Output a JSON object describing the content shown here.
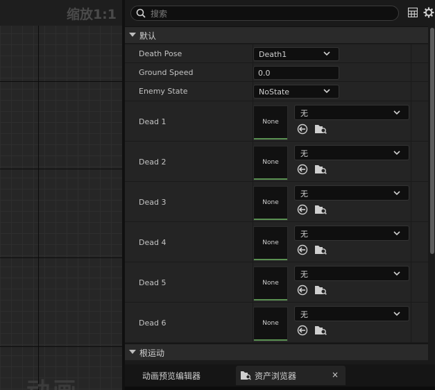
{
  "viewport": {
    "zoom_label": "缩放1:1",
    "ghost_text": "动画"
  },
  "search": {
    "placeholder": "搜索",
    "value": "",
    "icon": "search-icon"
  },
  "toolbar": {
    "table_icon": "table-view-icon",
    "settings_icon": "gear-icon"
  },
  "categories": {
    "default": "默认",
    "root_motion": "根运动"
  },
  "properties": {
    "death_pose": {
      "label": "Death Pose",
      "value": "Death1"
    },
    "ground_speed": {
      "label": "Ground Speed",
      "value": "0.0"
    },
    "enemy_state": {
      "label": "Enemy State",
      "value": "NoState"
    }
  },
  "dead_slots": [
    {
      "label": "Dead 1",
      "thumb": "None",
      "asset": "无"
    },
    {
      "label": "Dead 2",
      "thumb": "None",
      "asset": "无"
    },
    {
      "label": "Dead 3",
      "thumb": "None",
      "asset": "无"
    },
    {
      "label": "Dead 4",
      "thumb": "None",
      "asset": "无"
    },
    {
      "label": "Dead 5",
      "thumb": "None",
      "asset": "无"
    },
    {
      "label": "Dead 6",
      "thumb": "None",
      "asset": "无"
    }
  ],
  "tabs": {
    "anim_preview": "动画预览编辑器",
    "content_browser": "资产浏览器",
    "close": "×"
  },
  "colors": {
    "accent_green": "#5a9152",
    "panel_bg": "#242424"
  }
}
